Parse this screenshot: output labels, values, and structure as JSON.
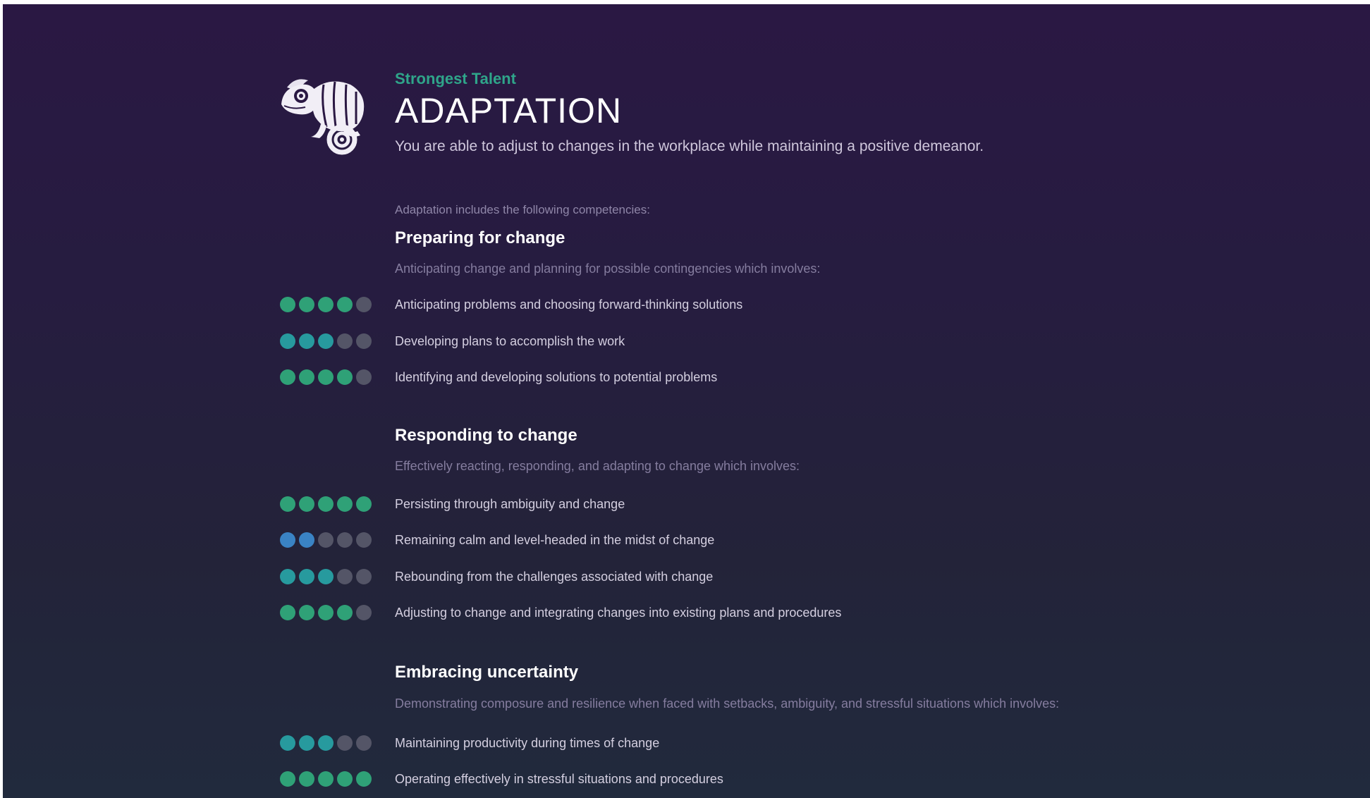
{
  "talent": {
    "eyebrow": "Strongest Talent",
    "title": "ADAPTATION",
    "description": "You are able to adjust to changes in the workplace while maintaining a positive demeanor.",
    "logo_icon": "chameleon-icon"
  },
  "intro": "Adaptation includes the following competencies:",
  "colors": {
    "green": "#2fa177",
    "teal": "#279a9e",
    "blue": "#3a83c4",
    "empty": "#545567"
  },
  "sections": [
    {
      "title": "Preparing for change",
      "description": "Anticipating change and planning for possible contingencies which involves:",
      "items": [
        {
          "label": "Anticipating problems and choosing forward-thinking solutions",
          "rating": 4,
          "max": 5,
          "color": "#2fa177"
        },
        {
          "label": "Developing plans to accomplish the work",
          "rating": 3,
          "max": 5,
          "color": "#279a9e"
        },
        {
          "label": "Identifying and developing solutions to potential problems",
          "rating": 4,
          "max": 5,
          "color": "#2fa177"
        }
      ]
    },
    {
      "title": "Responding to change",
      "description": "Effectively reacting, responding, and adapting to change which involves:",
      "items": [
        {
          "label": "Persisting through ambiguity and change",
          "rating": 5,
          "max": 5,
          "color": "#2fa177"
        },
        {
          "label": "Remaining calm and level-headed in the midst of change",
          "rating": 2,
          "max": 5,
          "color": "#3a83c4"
        },
        {
          "label": "Rebounding from the challenges associated with change",
          "rating": 3,
          "max": 5,
          "color": "#279a9e"
        },
        {
          "label": "Adjusting to change and integrating changes into existing plans and procedures",
          "rating": 4,
          "max": 5,
          "color": "#2fa177"
        }
      ]
    },
    {
      "title": "Embracing uncertainty",
      "description": "Demonstrating composure and resilience when faced with setbacks, ambiguity, and stressful situations which involves:",
      "items": [
        {
          "label": "Maintaining productivity during times of change",
          "rating": 3,
          "max": 5,
          "color": "#279a9e"
        },
        {
          "label": "Operating effectively in stressful situations and procedures",
          "rating": 5,
          "max": 5,
          "color": "#2fa177"
        }
      ]
    }
  ]
}
